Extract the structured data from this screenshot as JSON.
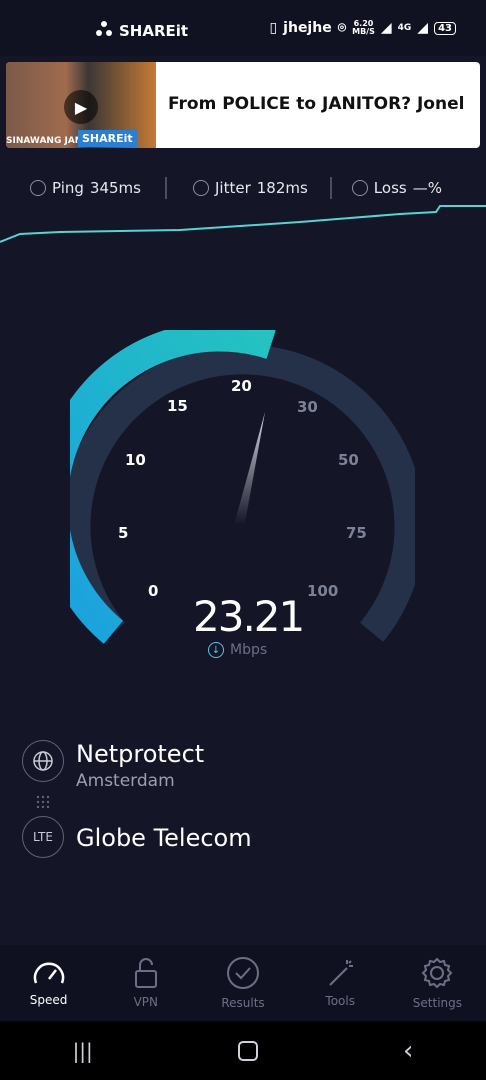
{
  "status_bar": {
    "app_label": "SHAREit",
    "user_label": "jhejhe",
    "net_speed_value": "6.20",
    "net_speed_unit": "MB/S",
    "network_type": "4G",
    "battery": "43"
  },
  "ad": {
    "image_caption": "SINAWANG JAN",
    "badge": "SHAREit",
    "headline": "From POLICE to JANITOR? Jonel"
  },
  "metrics": {
    "ping_label": "Ping",
    "ping_value": "345ms",
    "jitter_label": "Jitter",
    "jitter_value": "182ms",
    "loss_label": "Loss",
    "loss_value": "—%"
  },
  "gauge": {
    "value": "23.21",
    "unit": "Mbps",
    "ticks": [
      "0",
      "5",
      "10",
      "15",
      "20",
      "30",
      "50",
      "75",
      "100"
    ],
    "current_fraction": 0.44,
    "colors": {
      "accent": "#1aa7dd",
      "track": "#253149"
    }
  },
  "server": {
    "name": "Netprotect",
    "location": "Amsterdam"
  },
  "carrier": {
    "badge": "LTE",
    "name": "Globe Telecom"
  },
  "tabs": [
    {
      "label": "Speed",
      "icon": "speedometer-icon"
    },
    {
      "label": "VPN",
      "icon": "lock-icon"
    },
    {
      "label": "Results",
      "icon": "check-circle-icon"
    },
    {
      "label": "Tools",
      "icon": "magic-wand-icon"
    },
    {
      "label": "Settings",
      "icon": "gear-icon"
    }
  ]
}
